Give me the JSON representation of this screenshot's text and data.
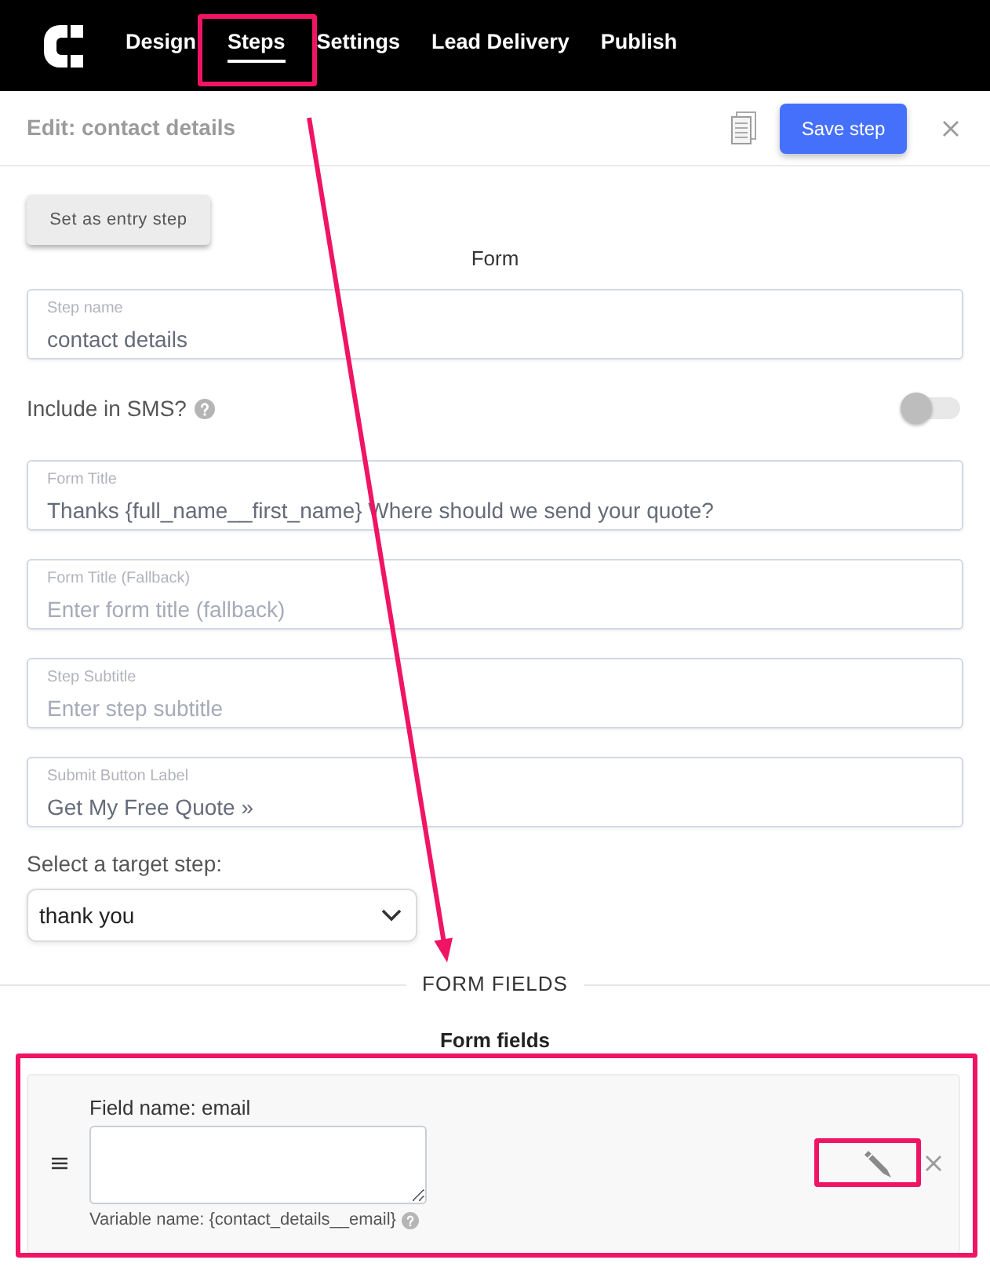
{
  "navbar": {
    "tabs": [
      {
        "label": "Design",
        "selected": false
      },
      {
        "label": "Steps",
        "selected": true
      },
      {
        "label": "Settings",
        "selected": false
      },
      {
        "label": "Lead Delivery",
        "selected": false
      },
      {
        "label": "Publish",
        "selected": false
      }
    ]
  },
  "header": {
    "title": "Edit: contact details",
    "save_button": "Save step"
  },
  "entry_step_button": "Set as entry step",
  "form": {
    "heading": "Form",
    "fields": [
      {
        "kind": "text",
        "label": "Step name",
        "value": "contact details"
      },
      {
        "kind": "toggle",
        "label": "Include in SMS?",
        "on": false
      },
      {
        "kind": "text",
        "label": "Form Title",
        "value": "Thanks {full_name__first_name} Where should we send your quote?"
      },
      {
        "kind": "text",
        "label": "Form Title (Fallback)",
        "placeholder": "Enter form title (fallback)"
      },
      {
        "kind": "text",
        "label": "Step Subtitle",
        "placeholder": "Enter step subtitle"
      },
      {
        "kind": "text",
        "label": "Submit Button Label",
        "value": "Get My Free Quote »"
      },
      {
        "kind": "select",
        "label": "Select a target step:",
        "value": "thank you"
      }
    ]
  },
  "form_fields": {
    "divider_label": "FORM FIELDS",
    "heading": "Form fields",
    "items": [
      {
        "field_name": "Field name: email",
        "variable_name": "Variable name: {contact_details__email}"
      }
    ]
  }
}
